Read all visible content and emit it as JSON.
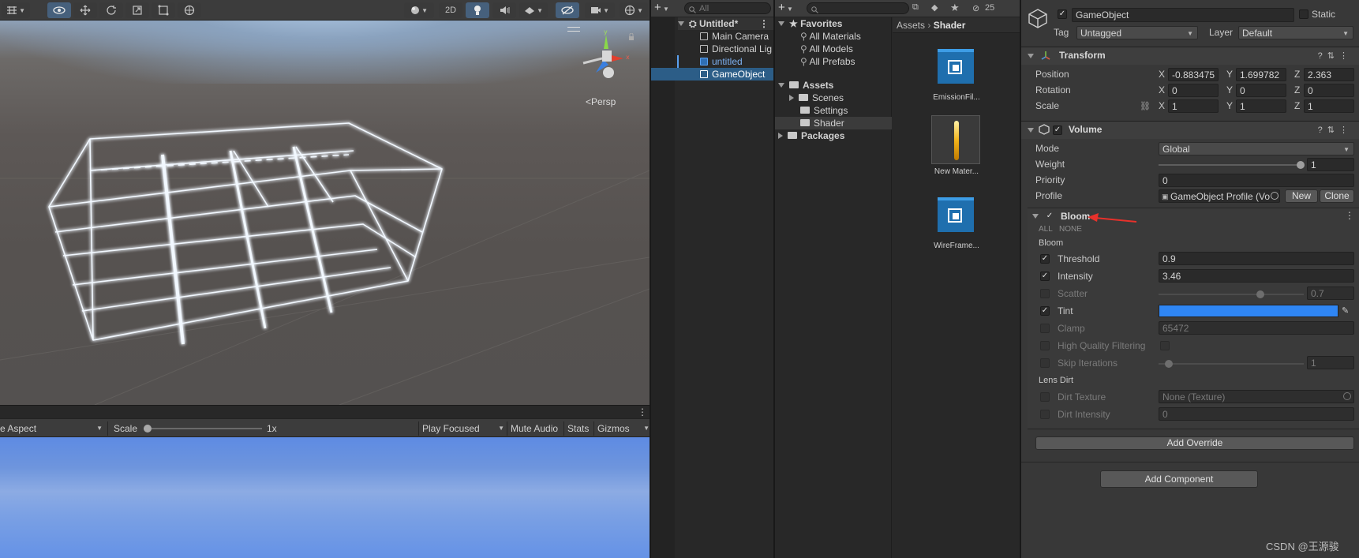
{
  "scene_toolbar": {
    "btn_2d": "2D",
    "icons": [
      "grid-icon",
      "visibility-icon",
      "move-icon",
      "rotate-icon",
      "scale-icon",
      "rect-icon",
      "transform-icon",
      "shading-icon",
      "lighting-icon",
      "audio-icon",
      "effects-icon",
      "hidden-icon",
      "camera-icon",
      "gizmos-icon"
    ]
  },
  "scene": {
    "persp_label": "<Persp",
    "gizmo_axes": [
      "y",
      "x",
      "z"
    ]
  },
  "game_bar": {
    "aspect": "e Aspect",
    "scale_label": "Scale",
    "scale_value": "1x",
    "play_focused": "Play Focused",
    "mute_audio": "Mute Audio",
    "stats": "Stats",
    "gizmos": "Gizmos"
  },
  "hierarchy": {
    "search_placeholder": "All",
    "scene_name": "Untitled*",
    "items": [
      {
        "label": "Main Camera"
      },
      {
        "label": "Directional Lig"
      },
      {
        "label": "untitled"
      },
      {
        "label": "GameObject"
      }
    ]
  },
  "project": {
    "favorites_label": "Favorites",
    "favorites": [
      "All Materials",
      "All Models",
      "All Prefabs"
    ],
    "assets_label": "Assets",
    "folders": [
      "Scenes",
      "Settings",
      "Shader"
    ],
    "packages_label": "Packages",
    "breadcrumb": [
      "Assets",
      "Shader"
    ],
    "count": "25",
    "assets_grid": [
      {
        "label": "EmissionFil..."
      },
      {
        "label": "New Mater..."
      },
      {
        "label": "WireFrame..."
      }
    ]
  },
  "inspector": {
    "object_name": "GameObject",
    "static_label": "Static",
    "tag_label": "Tag",
    "tag_value": "Untagged",
    "layer_label": "Layer",
    "layer_value": "Default",
    "transform": {
      "title": "Transform",
      "position_label": "Position",
      "rotation_label": "Rotation",
      "scale_label": "Scale",
      "position": {
        "x": "-0.883475",
        "y": "1.699782",
        "z": "2.363"
      },
      "rotation": {
        "x": "0",
        "y": "0",
        "z": "0"
      },
      "scale": {
        "x": "1",
        "y": "1",
        "z": "1"
      }
    },
    "volume": {
      "title": "Volume",
      "mode_label": "Mode",
      "mode_value": "Global",
      "weight_label": "Weight",
      "weight_value": "1",
      "weight_fraction": 1.0,
      "priority_label": "Priority",
      "priority_value": "0",
      "profile_label": "Profile",
      "profile_value": "GameObject Profile (Vo",
      "new_label": "New",
      "clone_label": "Clone"
    },
    "bloom": {
      "title": "Bloom",
      "all_label": "ALL",
      "none_label": "NONE",
      "section_bloom": "Bloom",
      "threshold_label": "Threshold",
      "threshold_value": "0.9",
      "intensity_label": "Intensity",
      "intensity_value": "3.46",
      "scatter_label": "Scatter",
      "scatter_value": "0.7",
      "scatter_fraction": 0.7,
      "tint_label": "Tint",
      "tint_color": "#2f86f4",
      "clamp_label": "Clamp",
      "clamp_value": "65472",
      "hq_label": "High Quality Filtering",
      "skip_label": "Skip Iterations",
      "skip_value": "1",
      "skip_fraction": 0.07,
      "section_lens": "Lens Dirt",
      "dirt_texture_label": "Dirt Texture",
      "dirt_texture_value": "None (Texture)",
      "dirt_intensity_label": "Dirt Intensity",
      "dirt_intensity_value": "0"
    },
    "add_override": "Add Override",
    "add_component": "Add Component"
  },
  "watermark": "CSDN @王源骏",
  "colors": {
    "selection": "#2c5d87",
    "accent_blue": "#2f86f4",
    "annotation_arrow": "#e8312b"
  }
}
